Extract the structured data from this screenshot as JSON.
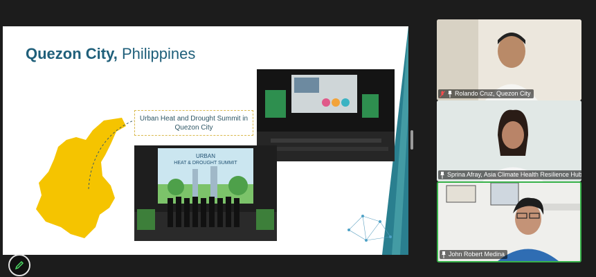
{
  "slide": {
    "title_bold": "Quezon City,",
    "title_rest": " Philippines",
    "callout_line1": "Urban Heat and Drought Summit in",
    "callout_line2": "Quezon City",
    "banner_line1": "URBAN",
    "banner_line2": "HEAT & DROUGHT SUMMIT",
    "colors": {
      "title": "#1f5f7a",
      "map": "#f5c400",
      "accent_teal": "#2a7f8f"
    }
  },
  "participants": [
    {
      "name": "Rolando Cruz, Quezon City",
      "muted": true
    },
    {
      "name": "Sprina Afray, Asia Climate Health Resilience Hub",
      "muted": false
    },
    {
      "name": "John Robert Medina",
      "muted": false,
      "speaking": true
    }
  ],
  "controls": {
    "annotate_icon": "pencil-icon"
  }
}
